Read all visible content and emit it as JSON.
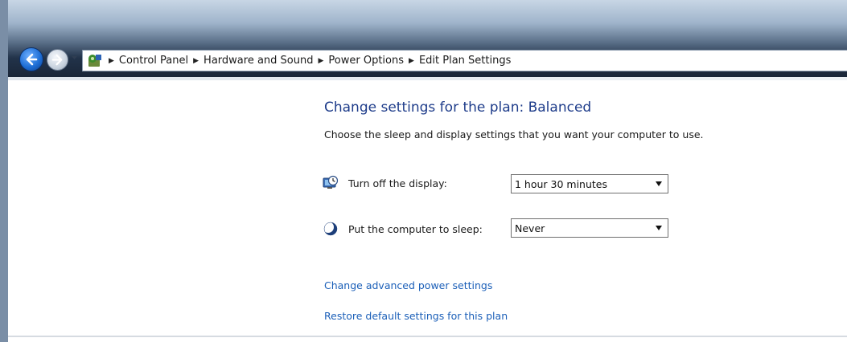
{
  "breadcrumbs": [
    "Control Panel",
    "Hardware and Sound",
    "Power Options",
    "Edit Plan Settings"
  ],
  "page": {
    "title": "Change settings for the plan: Balanced",
    "subtitle": "Choose the sleep and display settings that you want your computer to use."
  },
  "settings": {
    "display": {
      "label": "Turn off the display:",
      "value": "1 hour 30 minutes",
      "icon": "monitor-clock-icon"
    },
    "sleep": {
      "label": "Put the computer to sleep:",
      "value": "Never",
      "icon": "moon-icon"
    }
  },
  "links": {
    "advanced": "Change advanced power settings",
    "restore": "Restore default settings for this plan"
  },
  "colors": {
    "title": "#1e3c8a",
    "link": "#1b5fb8",
    "back_button": "#1f6fd6"
  }
}
